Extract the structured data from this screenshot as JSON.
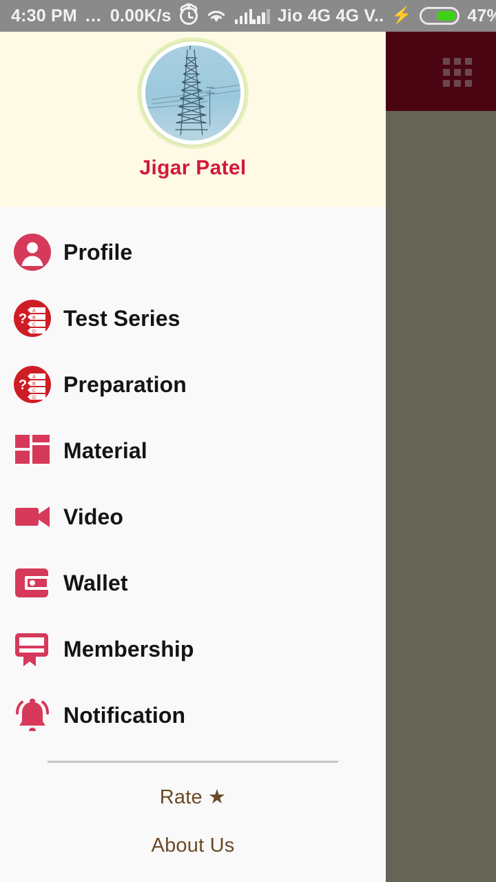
{
  "statusbar": {
    "time": "4:30 PM",
    "dots": "...",
    "netspeed": "0.00K/s",
    "alarm_icon": "alarm-icon",
    "wifi_icon": "wifi-icon",
    "signal_icon_1": "signal-bars-icon",
    "signal_icon_2": "signal-bars-icon",
    "carrier": "Jio 4G 4G V..",
    "charging_icon": "bolt-icon",
    "battery_icon": "battery-icon",
    "battery_level": "47%",
    "background": "#8a8a8a",
    "text_color": "#f2f2f2",
    "battery_fill_color": "#3fd117"
  },
  "background_app": {
    "appbar_color": "#4a0512",
    "grid_icon": "grid-menu-icon",
    "scrim_color": "#666357"
  },
  "drawer": {
    "background": "#f9f9f9",
    "header": {
      "background": "#fffae6",
      "avatar": "user-avatar-transmission-tower",
      "avatar_ring_color": "#ffffff",
      "avatar_glow_color": "#96cd3c",
      "username": "Jigar Patel",
      "username_color": "#d11a38"
    },
    "menu": [
      {
        "label": "Profile",
        "icon": "person-circle-icon",
        "color": "#d6395a"
      },
      {
        "label": "Test Series",
        "icon": "question-options-icon",
        "color": "#cf1d26"
      },
      {
        "label": "Preparation",
        "icon": "question-options-icon",
        "color": "#cf1d26"
      },
      {
        "label": "Material",
        "icon": "dashboard-grid-icon",
        "color": "#d6395a"
      },
      {
        "label": "Video",
        "icon": "video-camera-icon",
        "color": "#d6395a"
      },
      {
        "label": "Wallet",
        "icon": "wallet-icon",
        "color": "#d6395a"
      },
      {
        "label": "Membership",
        "icon": "membership-card-icon",
        "color": "#d6395a"
      },
      {
        "label": "Notification",
        "icon": "bell-icon",
        "color": "#d6395a"
      }
    ],
    "divider_color": "#c6c6c6",
    "footer": {
      "rate_label": "Rate ★",
      "about_label": "About Us",
      "link_color": "#6b4a26"
    }
  }
}
